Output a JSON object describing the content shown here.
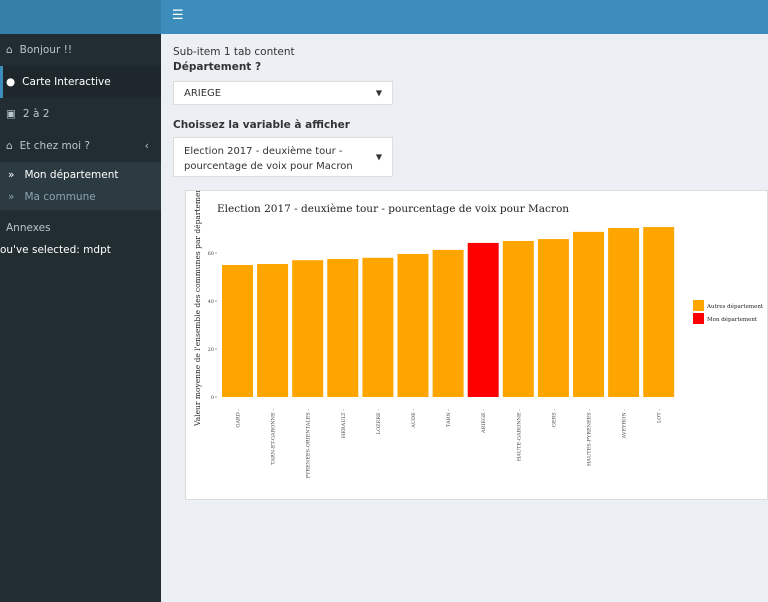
{
  "header": {
    "menu_icon": "hamburger-icon"
  },
  "sidebar": {
    "items": [
      {
        "label": "Bonjour !!",
        "icon": "home-icon"
      },
      {
        "label": "Carte Interactive",
        "icon": "globe-icon"
      },
      {
        "label": "2 à 2",
        "icon": "area-chart-icon"
      },
      {
        "label": "Et chez moi ?",
        "icon": "home-icon"
      }
    ],
    "subitems": [
      {
        "label": "Mon département"
      },
      {
        "label": "Ma commune"
      }
    ],
    "annexes": "Annexes",
    "selected": "ou've selected: mdpt"
  },
  "main": {
    "tab_content": "Sub-item 1 tab content",
    "dept_label": "Département ?",
    "dept_value": "ARIEGE",
    "var_label": "Choissez la variable à afficher",
    "var_value": "Election 2017 - deuxième tour - pourcentage de voix pour Macron"
  },
  "chart_data": {
    "type": "bar",
    "title": "Election 2017 - deuxième tour - pourcentage de voix pour Macron",
    "xlabel": "",
    "ylabel": "Valeur moyenne de l'ensemble des communes par département",
    "categories": [
      "GARD",
      "TARN-ET-GARONNE",
      "PYRENEES-ORIENTALES",
      "HERAULT",
      "LOZERE",
      "AUDE",
      "TARN",
      "ARIEGE",
      "HAUTE-GARONNE",
      "GERS",
      "HAUTES-PYRENEES",
      "AVEYRON",
      "LOT"
    ],
    "values": [
      55,
      55.4,
      57,
      57.5,
      58,
      59.6,
      61.3,
      64.2,
      65,
      65.8,
      68.8,
      70.4,
      70.8
    ],
    "highlight": "ARIEGE",
    "yticks": [
      "0",
      "20",
      "40",
      "60"
    ],
    "ylim": [
      0,
      75
    ],
    "legend": [
      {
        "name": "Autres département",
        "color": "#FFA500"
      },
      {
        "name": "Mon département",
        "color": "#FF0000"
      }
    ],
    "legend_position": "right",
    "grid": false
  }
}
